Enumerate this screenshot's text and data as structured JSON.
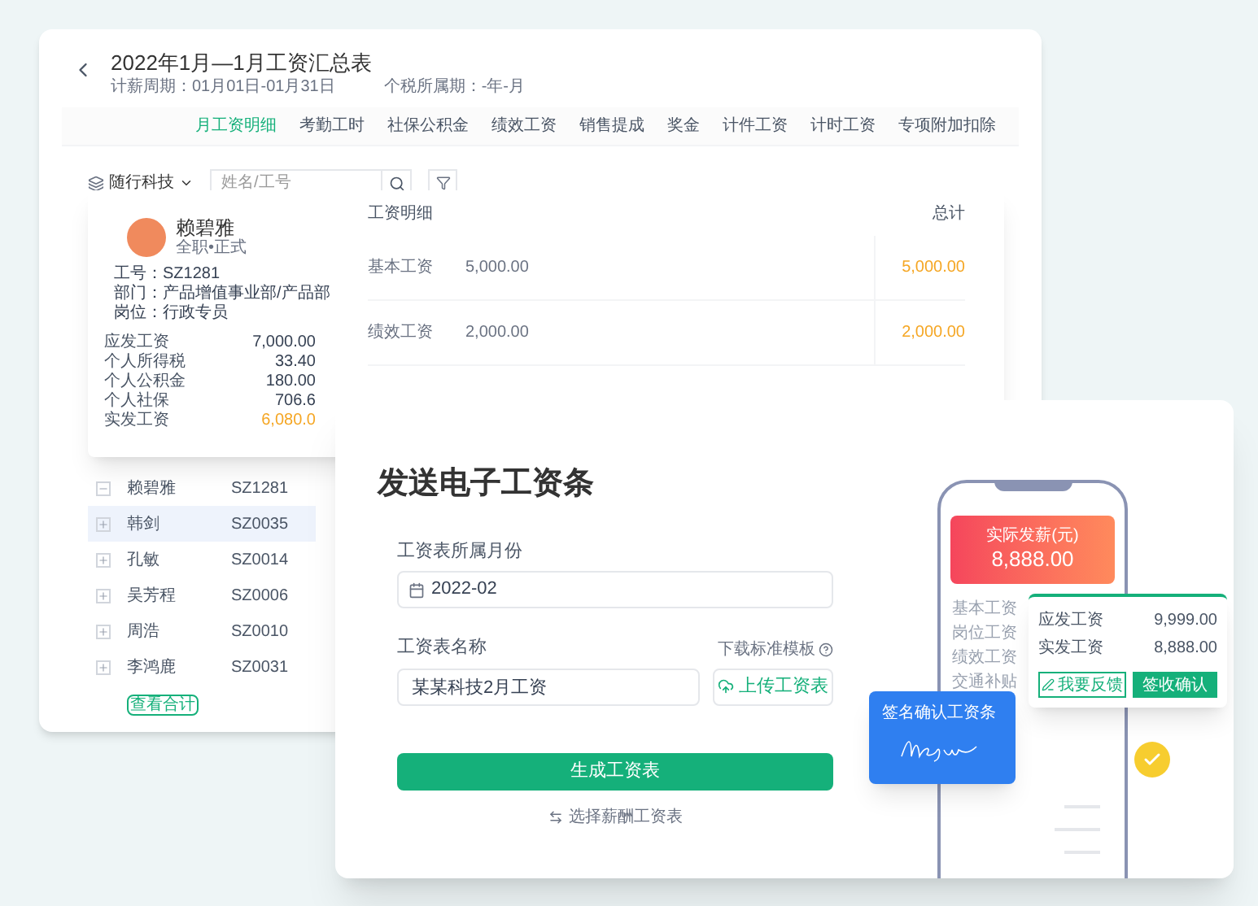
{
  "summary_window": {
    "title": "2022年1月—1月工资汇总表",
    "period": "计薪周期：01月01日-01月31日",
    "tax_period": "个税所属期：-年-月",
    "tabs": [
      {
        "label": "月工资明细",
        "selected": true
      },
      {
        "label": "考勤工时",
        "selected": false
      },
      {
        "label": "社保公积金",
        "selected": false
      },
      {
        "label": "绩效工资",
        "selected": false
      },
      {
        "label": "销售提成",
        "selected": false
      },
      {
        "label": "奖金",
        "selected": false
      },
      {
        "label": "计件工资",
        "selected": false
      },
      {
        "label": "计时工资",
        "selected": false
      },
      {
        "label": "专项附加扣除",
        "selected": false
      }
    ],
    "company": "随行科技",
    "search": {
      "placeholder": "姓名/工号"
    },
    "employees": [
      {
        "name": "赖碧雅",
        "id": "SZ1281",
        "expanded": true,
        "selected": false
      },
      {
        "name": "韩剑",
        "id": "SZ0035",
        "expanded": false,
        "selected": true
      },
      {
        "name": "孔敏",
        "id": "SZ0014",
        "expanded": false,
        "selected": false
      },
      {
        "name": "吴芳程",
        "id": "SZ0006",
        "expanded": false,
        "selected": false
      },
      {
        "name": "周浩",
        "id": "SZ0010",
        "expanded": false,
        "selected": false
      },
      {
        "name": "李鸿鹿",
        "id": "SZ0031",
        "expanded": false,
        "selected": false
      }
    ],
    "view_total_button": "查看合计"
  },
  "employee_popup": {
    "name": "赖碧雅",
    "employment": "全职•正式",
    "fields": [
      {
        "label": "工号：",
        "value": "SZ1281"
      },
      {
        "label": "部门：",
        "value": "产品增值事业部/产品部"
      },
      {
        "label": "岗位：",
        "value": "行政专员"
      }
    ],
    "pay_summary": [
      {
        "label": "应发工资",
        "value": "7,000.00",
        "kind": "normal"
      },
      {
        "label": "个人所得税",
        "value": "33.40",
        "kind": "normal"
      },
      {
        "label": "个人公积金",
        "value": "180.00",
        "kind": "normal"
      },
      {
        "label": "个人社保",
        "value": "706.6",
        "kind": "normal"
      },
      {
        "label": "实发工资",
        "value": "6,080.0",
        "kind": "total"
      }
    ],
    "details": {
      "columns": [
        "工资明细",
        "总计"
      ],
      "rows": [
        {
          "item": "基本工资",
          "amount": "5,000.00",
          "total": "5,000.00"
        },
        {
          "item": "绩效工资",
          "amount": "2,000.00",
          "total": "2,000.00"
        }
      ]
    }
  },
  "send_payslip": {
    "title": "发送电子工资条",
    "month_label": "工资表所属月份",
    "month_value": "2022-02",
    "name_label": "工资表名称",
    "template_link": "下载标准模板",
    "name_value": "某某科技2月工资",
    "upload_button": "上传工资表",
    "generate_button": "生成工资表",
    "switch_link": "选择薪酬工资表"
  },
  "phone": {
    "banner_label": "实际发薪(元)",
    "banner_amount": "8,888.00",
    "items": [
      "基本工资",
      "岗位工资",
      "绩效工资",
      "交通补贴"
    ],
    "summary_card": {
      "rows": [
        {
          "label": "应发工资",
          "value": "9,999.00"
        },
        {
          "label": "实发工资",
          "value": "8,888.00"
        }
      ],
      "feedback_button": "我要反馈",
      "confirm_button": "签收确认"
    },
    "signature_card": {
      "title": "签名确认工资条"
    }
  }
}
